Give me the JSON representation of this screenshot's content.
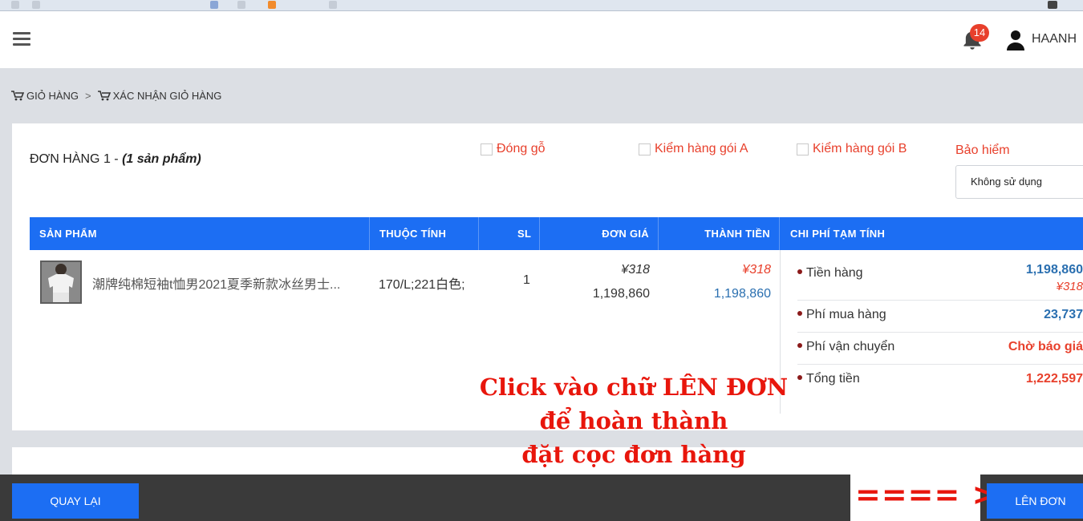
{
  "header": {
    "notifications_count": "14",
    "username": "HAANH"
  },
  "breadcrumb": {
    "item1": "GIỎ HÀNG",
    "separator": ">",
    "item2": "XÁC NHẬN GIỎ HÀNG"
  },
  "order": {
    "title": "ĐƠN HÀNG 1 - ",
    "count": "(1 sản phẩm)",
    "options": {
      "wood_packing": "Đóng gỗ",
      "inspect_a": "Kiểm hàng gói A",
      "inspect_b": "Kiểm hàng gói B"
    },
    "insurance_label": "Bảo hiểm",
    "insurance_value": "Không sử dụng"
  },
  "table": {
    "headers": {
      "product": "SẢN PHẨM",
      "attributes": "THUỘC TÍNH",
      "qty": "SL",
      "unit_price": "ĐƠN GIÁ",
      "line_total": "THÀNH TIỀN",
      "estimated_costs": "CHI PHÍ TẠM TÍNH"
    },
    "rows": [
      {
        "name": "潮牌纯棉短袖t恤男2021夏季新款冰丝男士...",
        "attributes": "170/L;221白色;",
        "qty": "1",
        "unit_price_cny": "¥318",
        "unit_price_vnd": "1,198,860",
        "total_cny": "¥318",
        "total_vnd": "1,198,860"
      }
    ]
  },
  "costs": {
    "goods_label": "Tiền hàng",
    "goods_vnd": "1,198,860",
    "goods_cny": "¥318",
    "purchase_fee_label": "Phí mua hàng",
    "purchase_fee": "23,737",
    "shipping_label": "Phí vận chuyển",
    "shipping_value": "Chờ báo giá",
    "total_label": "Tổng tiền",
    "total_value": "1,222,597"
  },
  "annotation": {
    "line1": "Click vào chữ LÊN ĐƠN",
    "line2": "để hoàn thành",
    "line3": "đặt cọc đơn hàng",
    "arrow": "==== >"
  },
  "footer": {
    "back_label": "QUAY LẠI",
    "submit_label": "LÊN ĐƠN"
  },
  "colors": {
    "primary_blue": "#1c6ef3",
    "accent_red": "#e8402c",
    "value_blue": "#2a6fb0",
    "annotation_red": "#e8160c"
  }
}
